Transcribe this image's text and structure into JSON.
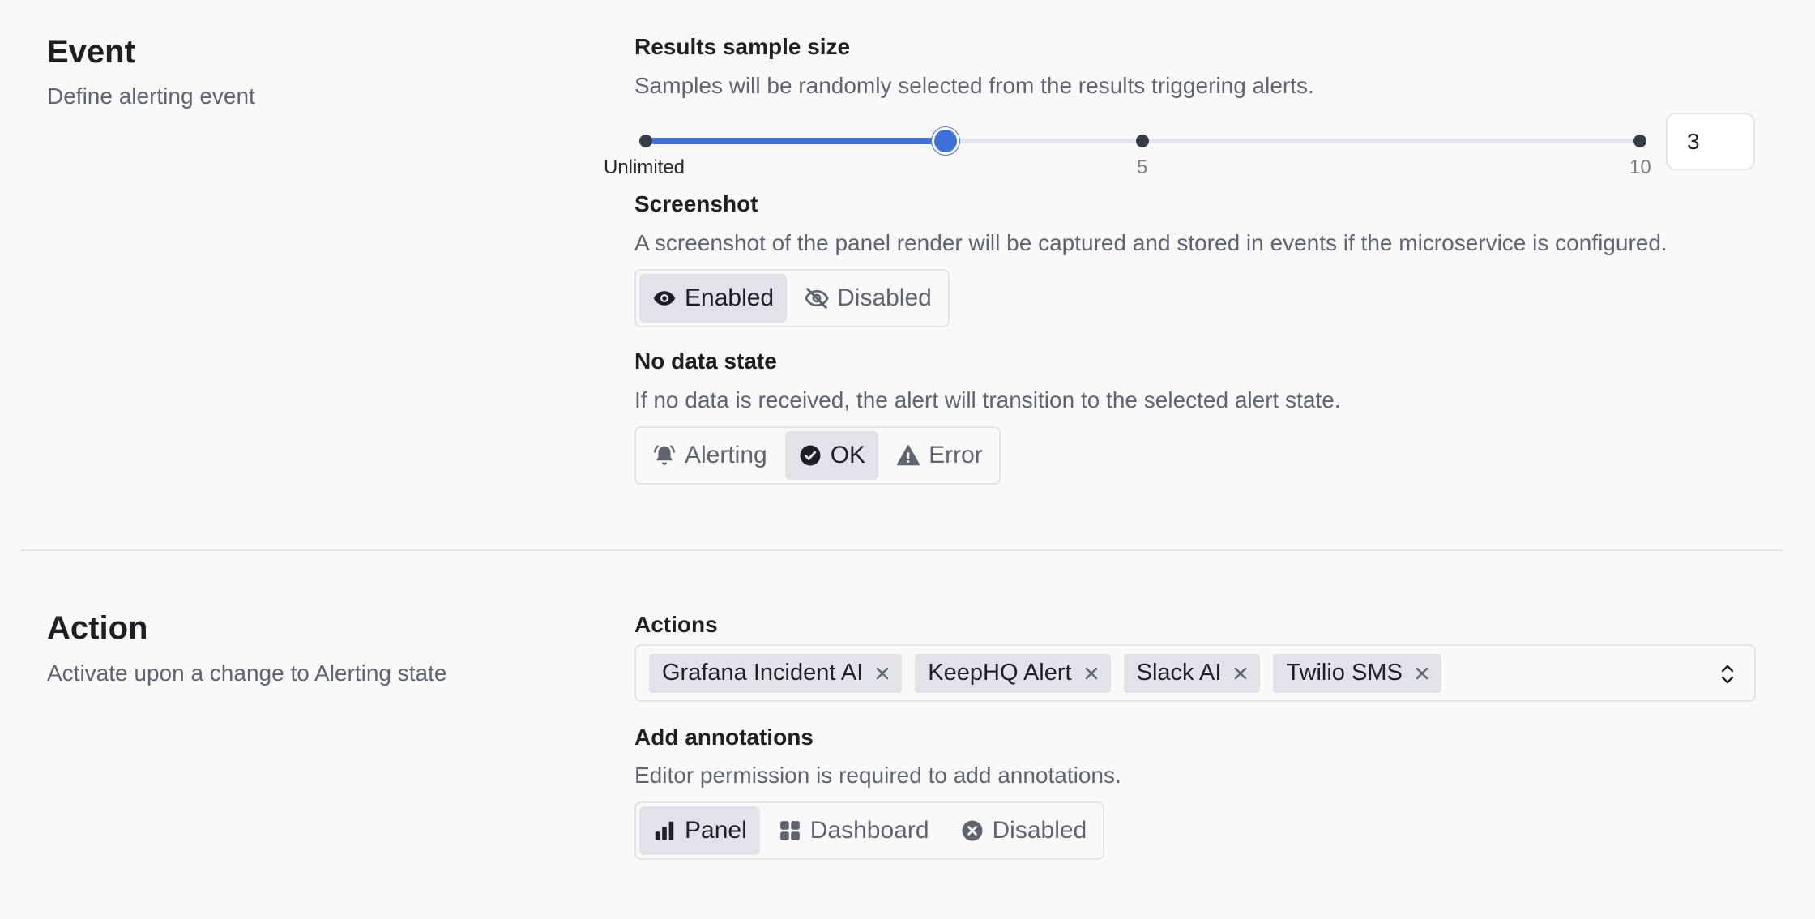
{
  "event": {
    "title": "Event",
    "description": "Define alerting event",
    "sample_size": {
      "label": "Results sample size",
      "description": "Samples will be randomly selected from the results triggering alerts.",
      "tick_labels": [
        "Unlimited",
        "5",
        "10"
      ],
      "value": "3",
      "value_fraction": 0.3
    },
    "screenshot": {
      "label": "Screenshot",
      "description": "A screenshot of the panel render will be captured and stored in events if the microservice is configured.",
      "options": [
        "Enabled",
        "Disabled"
      ],
      "selected": "Enabled"
    },
    "no_data_state": {
      "label": "No data state",
      "description": "If no data is received, the alert will transition to the selected alert state.",
      "options": [
        "Alerting",
        "OK",
        "Error"
      ],
      "selected": "OK"
    }
  },
  "action": {
    "title": "Action",
    "description": "Activate upon a change to Alerting state",
    "actions": {
      "label": "Actions",
      "selected": [
        "Grafana Incident AI",
        "KeepHQ Alert",
        "Slack AI",
        "Twilio SMS"
      ]
    },
    "annotations": {
      "label": "Add annotations",
      "description": "Editor permission is required to add annotations.",
      "options": [
        "Panel",
        "Dashboard",
        "Disabled"
      ],
      "selected": "Panel"
    }
  },
  "colors": {
    "accent": "#3d71d9",
    "active_segment": "#e2e3e6",
    "background": "#f9f9f9"
  }
}
